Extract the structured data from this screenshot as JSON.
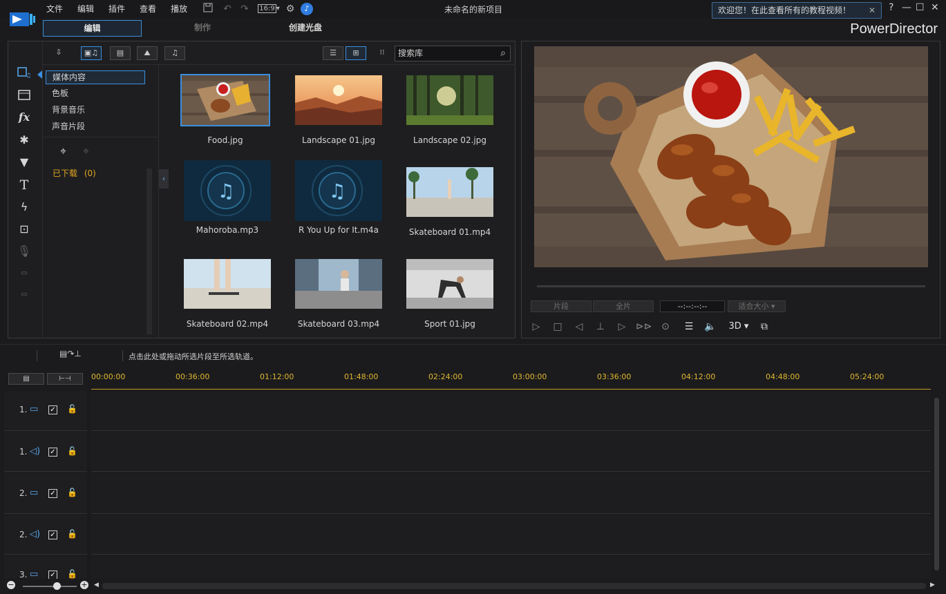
{
  "app": {
    "title": "未命名的新项目",
    "brand": "PowerDirector",
    "welcome": "欢迎您！在此查看所有的教程视频！"
  },
  "menu": [
    "文件",
    "编辑",
    "插件",
    "查看",
    "播放"
  ],
  "aspect_ratio": "16:9",
  "mode_tabs": {
    "edit": "编辑",
    "produce": "制作",
    "disc": "创建光盘"
  },
  "library": {
    "search_placeholder": "搜索库",
    "categories": [
      "媒体内容",
      "色板",
      "背景音乐",
      "声音片段"
    ],
    "downloaded": "已下载",
    "downloaded_count": "(0)",
    "items": [
      {
        "name": "Food.jpg",
        "kind": "image"
      },
      {
        "name": "Landscape 01.jpg",
        "kind": "image"
      },
      {
        "name": "Landscape 02.jpg",
        "kind": "image"
      },
      {
        "name": "Mahoroba.mp3",
        "kind": "audio"
      },
      {
        "name": "R You Up for It.m4a",
        "kind": "audio"
      },
      {
        "name": "Skateboard 01.mp4",
        "kind": "video"
      },
      {
        "name": "Skateboard 02.mp4",
        "kind": "video"
      },
      {
        "name": "Skateboard 03.mp4",
        "kind": "video"
      },
      {
        "name": "Sport 01.jpg",
        "kind": "image"
      }
    ]
  },
  "preview": {
    "clip_label": "片段",
    "movie_label": "全片",
    "timecode": "--:--:--:--",
    "fit_label": "适合大小",
    "mode_3d": "3D"
  },
  "timeline": {
    "hint": "点击此处或拖动所选片段至所选轨道。",
    "ticks": [
      "00:00:00",
      "00:36:00",
      "01:12:00",
      "01:48:00",
      "02:24:00",
      "03:00:00",
      "03:36:00",
      "04:12:00",
      "04:48:00",
      "05:24:00"
    ],
    "tracks": [
      {
        "num": "1.",
        "type": "video"
      },
      {
        "num": "1.",
        "type": "audio"
      },
      {
        "num": "2.",
        "type": "video"
      },
      {
        "num": "2.",
        "type": "audio"
      },
      {
        "num": "3.",
        "type": "video"
      }
    ]
  },
  "colors": {
    "accent": "#3a8fe0",
    "ruler": "#e0b830",
    "download": "#e0a620"
  }
}
